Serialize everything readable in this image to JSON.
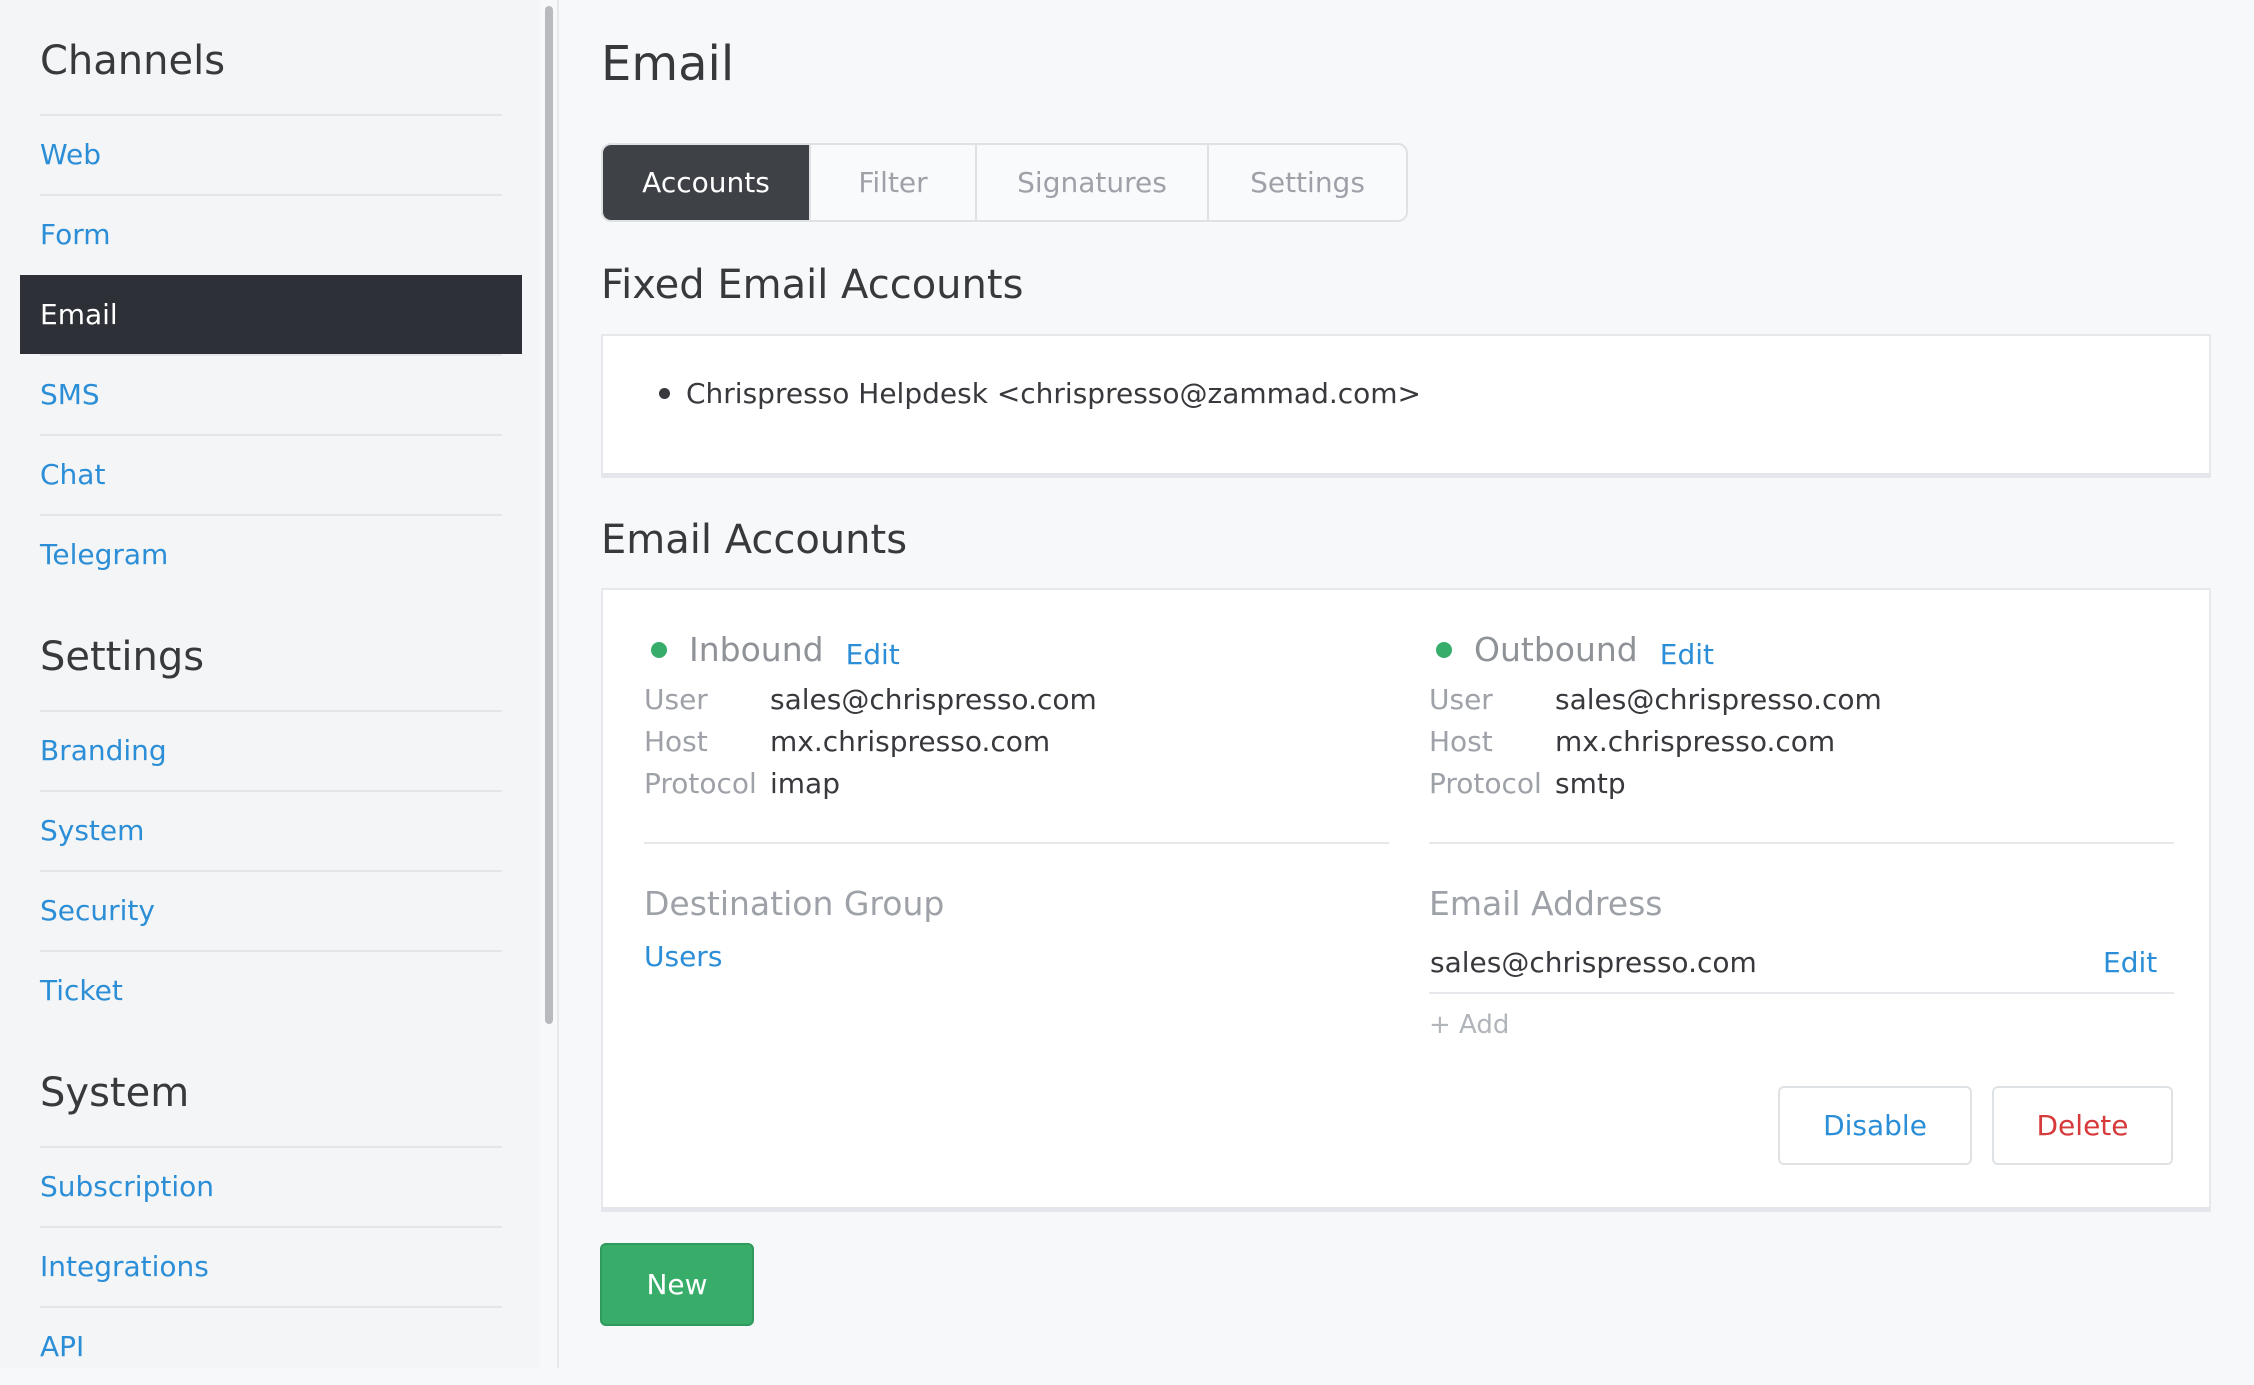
{
  "sidebar": {
    "sections": [
      {
        "heading": "Channels",
        "items": [
          "Web",
          "Form",
          "Email",
          "SMS",
          "Chat",
          "Telegram"
        ]
      },
      {
        "heading": "Settings",
        "items": [
          "Branding",
          "System",
          "Security",
          "Ticket"
        ]
      },
      {
        "heading": "System",
        "items": [
          "Subscription",
          "Integrations",
          "API"
        ]
      }
    ],
    "active_item": "Email"
  },
  "page": {
    "title": "Email",
    "tabs": [
      "Accounts",
      "Filter",
      "Signatures",
      "Settings"
    ],
    "active_tab": "Accounts"
  },
  "fixed_accounts": {
    "heading": "Fixed Email Accounts",
    "items": [
      "Chrispresso Helpdesk <chrispresso@zammad.com>"
    ]
  },
  "email_accounts": {
    "heading": "Email Accounts",
    "inbound": {
      "label": "Inbound",
      "edit": "Edit",
      "status_color": "#36ad6a",
      "fields": [
        {
          "key": "User",
          "value": "sales@chrispresso.com"
        },
        {
          "key": "Host",
          "value": "mx.chrispresso.com"
        },
        {
          "key": "Protocol",
          "value": "imap"
        }
      ]
    },
    "outbound": {
      "label": "Outbound",
      "edit": "Edit",
      "status_color": "#36ad6a",
      "fields": [
        {
          "key": "User",
          "value": "sales@chrispresso.com"
        },
        {
          "key": "Host",
          "value": "mx.chrispresso.com"
        },
        {
          "key": "Protocol",
          "value": "smtp"
        }
      ]
    },
    "destination_group": {
      "label": "Destination Group",
      "value": "Users"
    },
    "email_address": {
      "label": "Email Address",
      "value": "sales@chrispresso.com",
      "edit": "Edit",
      "add": "+ Add"
    },
    "buttons": {
      "disable": "Disable",
      "delete": "Delete"
    }
  },
  "new_button": "New",
  "colors": {
    "accent": "#2b8ed6",
    "active_nav_bg": "#2e3037",
    "new_button": "#38ad69",
    "delete": "#d63a3a"
  }
}
